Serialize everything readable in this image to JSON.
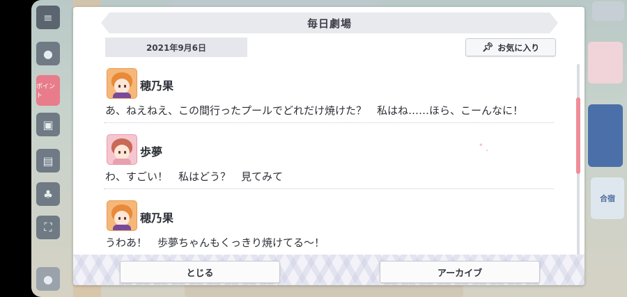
{
  "dialog": {
    "title": "毎日劇場",
    "date": "2021年9月6日",
    "favorite_label": "お気に入り",
    "entries": [
      {
        "speaker": "穂乃果",
        "text": "あ、ねえねえ、この間行ったプールでどれだけ焼けた？　私はね……ほら、こーんなに！"
      },
      {
        "speaker": "歩夢",
        "text": "わ、すごい！　私はどう？　見てみて"
      },
      {
        "speaker": "穂乃果",
        "text": "うわあ！　歩夢ちゃんもくっきり焼けてる～！"
      }
    ],
    "close_label": "とじる",
    "archive_label": "アーカイブ",
    "scroll_position": 0.25
  },
  "background": {
    "menu_badge": "ポイント",
    "side_label": "合宿"
  },
  "colors": {
    "accent_pink": "#ef8d9a",
    "header_gray": "#e8eaee",
    "avatar_honoka": "#f5b879",
    "avatar_ayumu": "#f5c6cf"
  },
  "icons": [
    "menu-icon",
    "chat-icon",
    "gift-icon",
    "present-icon",
    "dice-icon",
    "expand-icon",
    "pin-icon"
  ]
}
